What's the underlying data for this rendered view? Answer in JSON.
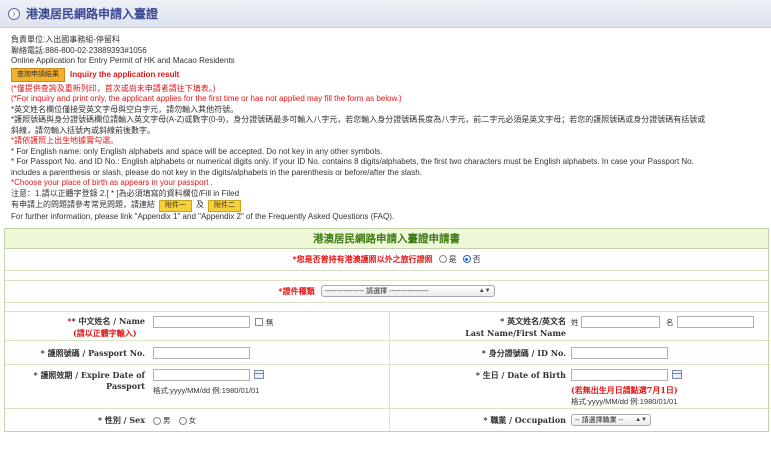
{
  "window": {
    "title": "港澳居民網路申請入臺證"
  },
  "intro": {
    "line1": "負責單位:入出國事務組-停留科",
    "line2": "聯絡電話:886-800-02-23889393#1056",
    "line3": "Online Application for Entry Permit of HK and Macao Residents",
    "query_button": "查詢申請結果",
    "query_label": "Inquiry the application result",
    "notice_zh": "(*僅提供查詢及重新列印，首次或尚未申請者請往下填表。)",
    "notice_en": "(*For inquiry and print only, the applicant applies for the first time or has not applied may fill the form as below.)",
    "rule1": "*英文姓名欄位僅接受英文字母與空白字元，請勿輸入其他符號。",
    "rule2": "*護照號碼與身分證號碼欄位請輸入英文字母(A-Z)或數字(0-9)，身分證號碼最多可輸入八字元，若您輸入身分證號碼長度為八字元，前二字元必須是英文字母；若您的護照號碼或身分證號碼有括號或",
    "rule3": "斜線，請勿輸入括號內或斜線前後數字。",
    "rule4": "*請依護照上出生地據實勾選。",
    "rule5": "* For English name: only English alphabets and space will be  accepted. Do not  key in any other symbols.",
    "rule6": "* For Passport No. and ID No.: English alphabets or numerical digits only. If your ID No. contains 8 digits/alphabets, the first two characters must be English alphabets. In case your Passport No.",
    "rule7": "includes a parenthesis or slash, please do not key in the digits/alphabets in the parenthesis or before/after the slash.",
    "rule8": "*Choose your place of birth as appears in your passport .",
    "note": "注意：1.請以正體字登錄 2.[ * ]為必須填寫的資料欄位/Fill in Filed",
    "faq_zh_prefix": "有申請上的問題請參考常見問題，請連結",
    "appendix1": "附件一",
    "and": "及",
    "appendix2": "附件二",
    "faq_en": "For further information, please link \"Appendix 1\" and \"Appendix 2\" of the Frequently Asked Questions (FAQ)."
  },
  "form": {
    "header": "港澳居民網路申請入臺證申請書",
    "travel_doc_q": "*您是否曾持有港澳護照以外之旅行證照",
    "yes": "是",
    "no": "否",
    "doc_type_label": "*證件種類",
    "doc_type_select": "----------------- 請選擇 -----------------",
    "chinese_name_label": "* 中文姓名 / Name",
    "chinese_name_note": "(請以正體字輸入)",
    "none_label": "無",
    "english_name_label": "* 英文姓名/英文名",
    "surname": "姓",
    "given": "名",
    "english_name_sub": "Last Name/First Name",
    "passport_label": "* 護照號碼 / Passport No.",
    "id_label": "* 身分證號碼 / ID No.",
    "expire_label": "* 護照效期 / Expire Date of Passport",
    "format_hint": "格式:yyyy/MM/dd      例:1980/01/01",
    "dob_label": "* 生日 / Date of Birth",
    "dob_note": "(若無出生月日請點選7月1日)",
    "sex_label": "* 性別 / Sex",
    "male": "男",
    "female": "女",
    "occupation_label": "* 職業 / Occupation",
    "occupation_select": "-- 請選擇職業 --"
  }
}
